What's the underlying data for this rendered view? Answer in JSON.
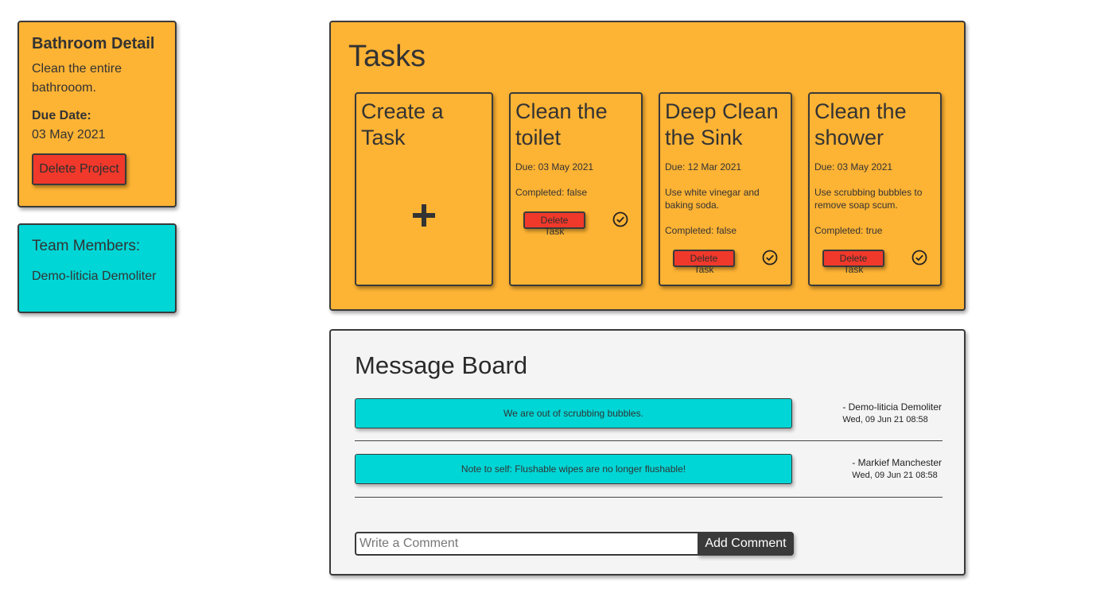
{
  "project": {
    "title": "Bathroom Detail",
    "description": "Clean the entire bathrooom.",
    "due_label": "Due Date:",
    "due_date": "03 May 2021",
    "delete_label": "Delete Project"
  },
  "team": {
    "title": "Team Members:",
    "members": [
      "Demo-liticia Demoliter"
    ]
  },
  "tasks": {
    "title": "Tasks",
    "create_label": "Create a Task",
    "items": [
      {
        "title": "Clean the toilet",
        "due": "Due: 03 May 2021",
        "description": "",
        "completed": "Completed: false",
        "delete_label": "Delete Task"
      },
      {
        "title": "Deep Clean the Sink",
        "due": "Due: 12 Mar 2021",
        "description": "Use white vinegar and baking soda.",
        "completed": "Completed: false",
        "delete_label": "Delete Task"
      },
      {
        "title": "Clean the shower",
        "due": "Due: 03 May 2021",
        "description": "Use scrubbing bubbles to remove soap scum.",
        "completed": "Completed: true",
        "delete_label": "Delete Task"
      }
    ]
  },
  "board": {
    "title": "Message Board",
    "messages": [
      {
        "text": "We are out of scrubbing bubbles.",
        "author": "- Demo-liticia Demoliter",
        "date": "Wed, 09 Jun 21 08:58"
      },
      {
        "text": "Note to self: Flushable wipes are no longer flushable!",
        "author": "- Markief Manchester",
        "date": "Wed, 09 Jun 21 08:58"
      }
    ],
    "comment_placeholder": "Write a Comment",
    "add_comment_label": "Add Comment"
  },
  "colors": {
    "orange": "#fdb334",
    "cyan": "#00d6d6",
    "red": "#f0392b",
    "dark": "#3a3a3a"
  },
  "icons": {
    "create": "plus-icon",
    "complete": "check-circle-icon"
  }
}
